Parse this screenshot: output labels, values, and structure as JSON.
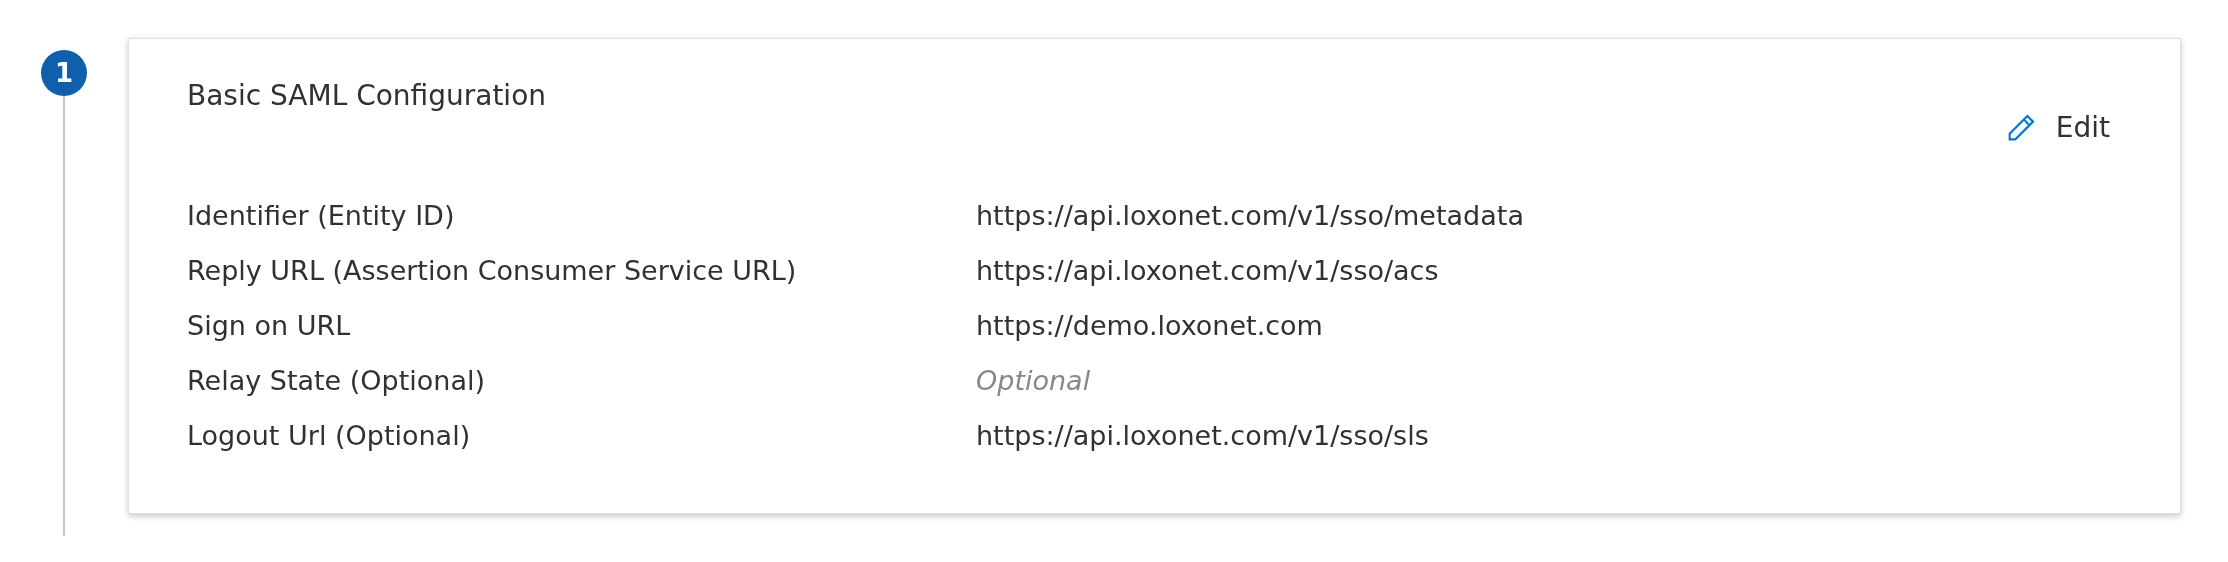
{
  "step": {
    "number": "1"
  },
  "card": {
    "title": "Basic SAML Configuration",
    "edit_label": "Edit",
    "rows": [
      {
        "label": "Identifier (Entity ID)",
        "value": "https://api.loxonet.com/v1/sso/metadata"
      },
      {
        "label": "Reply URL (Assertion Consumer Service URL)",
        "value": "https://api.loxonet.com/v1/sso/acs"
      },
      {
        "label": "Sign on URL",
        "value": "https://demo.loxonet.com"
      },
      {
        "label": "Relay State (Optional)",
        "value": "Optional",
        "kind": "hint"
      },
      {
        "label": "Logout Url (Optional)",
        "value": "https://api.loxonet.com/v1/sso/sls"
      }
    ]
  }
}
